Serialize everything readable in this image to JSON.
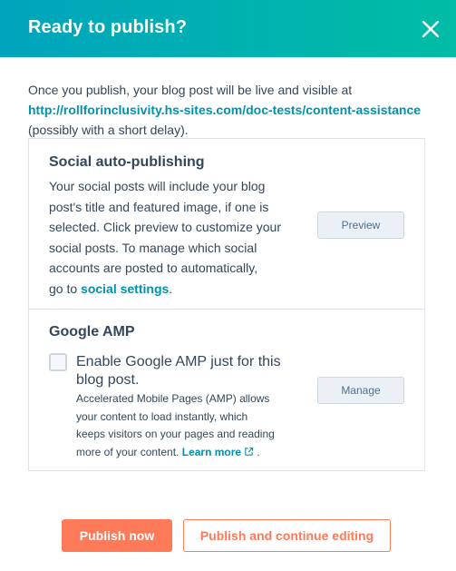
{
  "dialog": {
    "title": "Ready to publish?",
    "close_icon": "close-icon"
  },
  "intro": {
    "line1": "Once you publish, your blog post will be live and visible at",
    "url": "http://rollforinclusivity.hs-sites.com/doc-tests/content-assistance",
    "line3": "(possibly with a short delay)."
  },
  "social": {
    "title": "Social auto-publishing",
    "desc_lines": [
      "Your social posts will include your blog",
      "post's title and featured image, if one is",
      "selected. Click preview to customize your",
      "social posts. To manage which social",
      "accounts are posted to automatically,"
    ],
    "desc_prefix": "go to ",
    "settings_link": "social settings",
    "desc_suffix": ".",
    "preview_label": "Preview"
  },
  "amp": {
    "title": "Google AMP",
    "checkbox_checked": false,
    "label_lines": [
      "Enable Google AMP just for this",
      "blog post."
    ],
    "desc_lines": [
      "Accelerated Mobile Pages (AMP) allows",
      "your content to load instantly, which",
      "keeps visitors on your pages and reading"
    ],
    "desc_last_prefix": "more of your content. ",
    "learn_more": "Learn more",
    "external_icon": "external-link-icon",
    "desc_last_suffix": " .",
    "manage_label": "Manage"
  },
  "footer": {
    "publish_now": "Publish now",
    "publish_continue": "Publish and continue editing"
  },
  "colors": {
    "header_gradient_start": "#00a4bd",
    "header_gradient_end": "#00bda5",
    "link": "#0091ae",
    "primary": "#ff7a59"
  }
}
